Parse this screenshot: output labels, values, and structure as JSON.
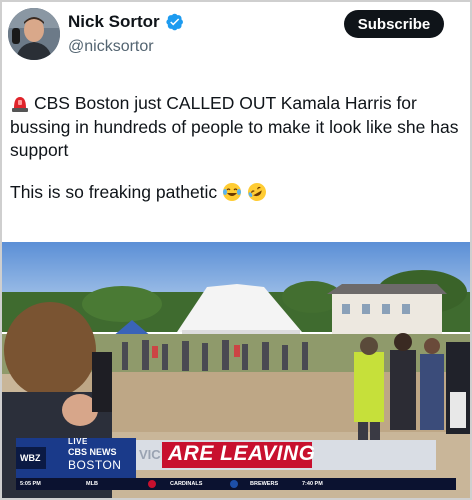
{
  "author": {
    "name": "Nick Sortor",
    "handle": "@nicksortor",
    "verified": true
  },
  "subscribe_label": "Subscribe",
  "tweet": {
    "line1": "CBS Boston just CALLED OUT Kamala Harris for bussing in hundreds of people to make it look like she has support",
    "line2": "This is so freaking pathetic"
  },
  "video": {
    "live_label": "LIVE",
    "network": "CBS NEWS",
    "city": "BOSTON",
    "station": "WBZ",
    "headline_fragment": "VIC",
    "headline": "ARE LEAVING",
    "ticker": {
      "time_left": "5:05 PM",
      "league": "MLB",
      "team1": "CARDINALS",
      "team2": "BREWERS",
      "time_right": "7:40 PM"
    }
  },
  "colors": {
    "verified": "#1d9bf0",
    "subscribe_bg": "#0f1419",
    "chyron_blue": "#1a3a8a",
    "chyron_red": "#c8102e"
  }
}
